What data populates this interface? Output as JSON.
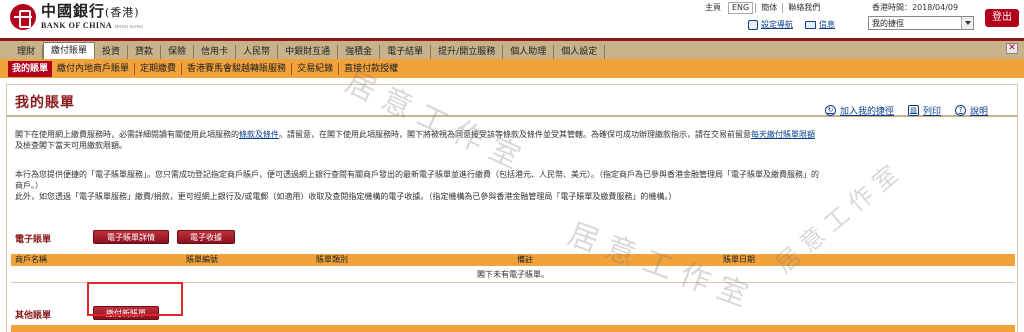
{
  "brand": {
    "name_cn": "中國銀行",
    "name_cn_suffix": "(香港)",
    "name_en": "BANK OF CHINA",
    "name_en_suffix": "HONG KONG"
  },
  "top_links": [
    "主頁",
    "ENG",
    "簡体",
    "聯絡我們"
  ],
  "hk_time": "香港時間：2018/04/09",
  "settings_nav": "設定導航",
  "messages": "信息",
  "shortcut_select": "我的捷徑",
  "logout": "登出",
  "main_tabs": [
    "理財",
    "繳付賬單",
    "投資",
    "貸款",
    "保險",
    "信用卡",
    "人民幣",
    "中銀財互通",
    "強積金",
    "電子結單",
    "提升/開立服務",
    "個人助理",
    "個人設定"
  ],
  "sub_tabs": [
    "我的賬單",
    "繳付內地商戶賬單",
    "定期繳費",
    "香港賽馬會駿越轉賬服務",
    "交易紀錄",
    "直接付款授權"
  ],
  "page_title": "我的賬單",
  "actions": {
    "add_shortcut": "加入我的捷徑",
    "print": "列印",
    "help": "說明"
  },
  "para1": {
    "a": "閣下在使用網上繳費服務時，必需詳細閱讀有關使用此項服務的",
    "terms": "條款及條件",
    "b": "。請留意，在閣下使用此項服務時，閣下將被視為同意接受該等條款及條件並受其管轄。為確保可成功辦理繳款指示，請在交易前留意",
    "limit": "每天繳付賬單限額",
    "c": "及檢查閣下當天可用繳款限額。"
  },
  "para2": {
    "line1": "本行為您提供便捷的「電子賬單服務」。您只需成功登記指定商戶賬戶，便可透過網上銀行查閱有關商戶發出的最新電子賬單並進行繳費（包括港元、人民幣、美元）。（指定商戶為已參與香港金融管理局「電子賬單及繳費服務」的",
    "line2": "商戶。）",
    "line3": "此外，如您透過「電子賬單服務」繳費/捐款，更可經網上銀行及/或電郵（如適用）收取及查閱指定機構的電子收據。（指定機構為已參與香港金融管理局「電子賬單及繳費服務」的機構。）"
  },
  "ebill_section": {
    "label": "電子賬單",
    "details_button": "電子賬單詳情",
    "receipt_button": "電子收據"
  },
  "table": {
    "headers": [
      "商戶名稱",
      "賬單編號",
      "賬單類別",
      "備註",
      "賬單日期"
    ],
    "empty_message": "閣下未有電子賬單。"
  },
  "other_section": {
    "label": "其他賬單",
    "pay_new_button": "繳付新賬單"
  },
  "watermark_text": "居 意 工 作 室"
}
